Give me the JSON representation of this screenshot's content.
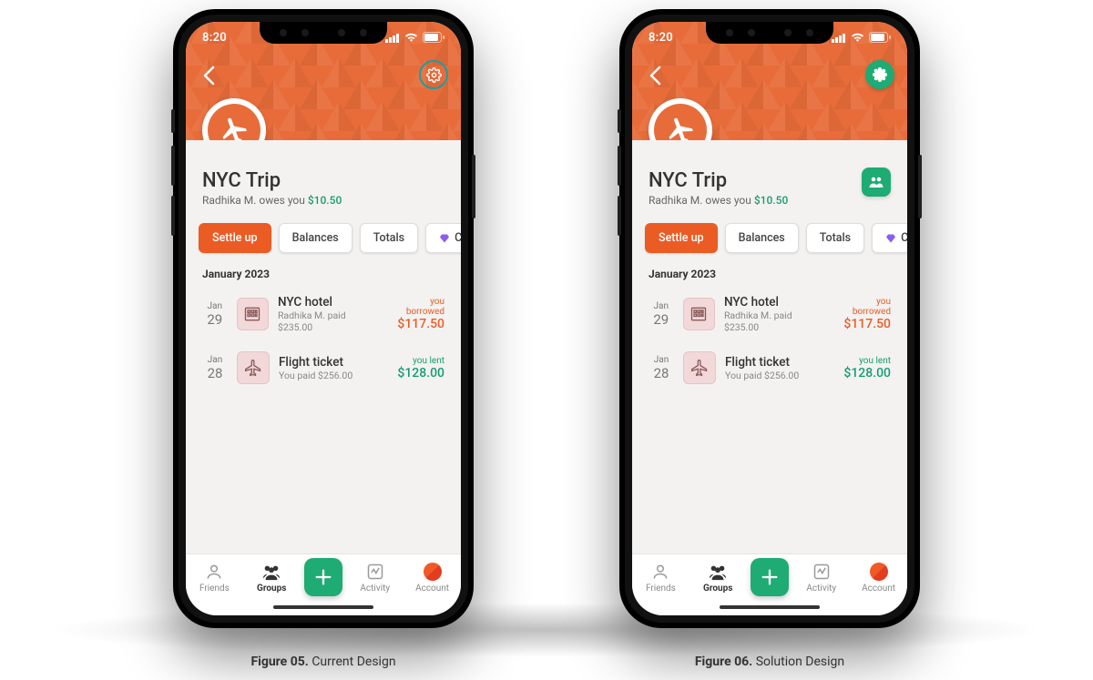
{
  "status": {
    "time": "8:20"
  },
  "group": {
    "title": "NYC Trip",
    "subtitle_prefix": "Radhika M. owes you ",
    "subtitle_amount": "$10.50"
  },
  "chips": {
    "settle_up": "Settle up",
    "balances": "Balances",
    "totals": "Totals",
    "charts": "Chart"
  },
  "section_label": "January 2023",
  "expenses": [
    {
      "month": "Jan",
      "day": "29",
      "title": "NYC hotel",
      "subtitle": "Radhika M. paid $235.00",
      "status_label": "you borrowed",
      "amount": "$117.50",
      "kind": "borrowed",
      "icon": "building"
    },
    {
      "month": "Jan",
      "day": "28",
      "title": "Flight ticket",
      "subtitle": "You paid $256.00",
      "status_label": "you lent",
      "amount": "$128.00",
      "kind": "lent",
      "icon": "plane"
    }
  ],
  "nav": {
    "friends": "Friends",
    "groups": "Groups",
    "activity": "Activity",
    "account": "Account"
  },
  "captions": {
    "fig05_bold": "Figure 05.",
    "fig05_rest": " Current Design",
    "fig06_bold": "Figure 06.",
    "fig06_rest": " Solution Design"
  }
}
